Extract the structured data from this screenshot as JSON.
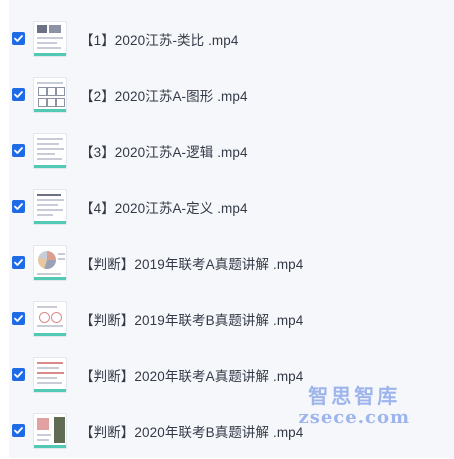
{
  "files": [
    {
      "name": "【1】2020江苏-类比 .mp4",
      "checked": true
    },
    {
      "name": "【2】2020江苏A-图形 .mp4",
      "checked": true
    },
    {
      "name": "【3】2020江苏A-逻辑 .mp4",
      "checked": true
    },
    {
      "name": "【4】2020江苏A-定义 .mp4",
      "checked": true
    },
    {
      "name": "【判断】2019年联考A真题讲解 .mp4",
      "checked": true
    },
    {
      "name": "【判断】2019年联考B真题讲解 .mp4",
      "checked": true
    },
    {
      "name": "【判断】2020年联考A真题讲解 .mp4",
      "checked": true
    },
    {
      "name": "【判断】2020年联考B真题讲解 .mp4",
      "checked": true
    }
  ],
  "watermark": {
    "title": "智思智库",
    "url": "zsece.com"
  },
  "colors": {
    "checkbox": "#1e6be6",
    "accent_teal": "#52c9b5",
    "watermark": "#9db5ec"
  }
}
